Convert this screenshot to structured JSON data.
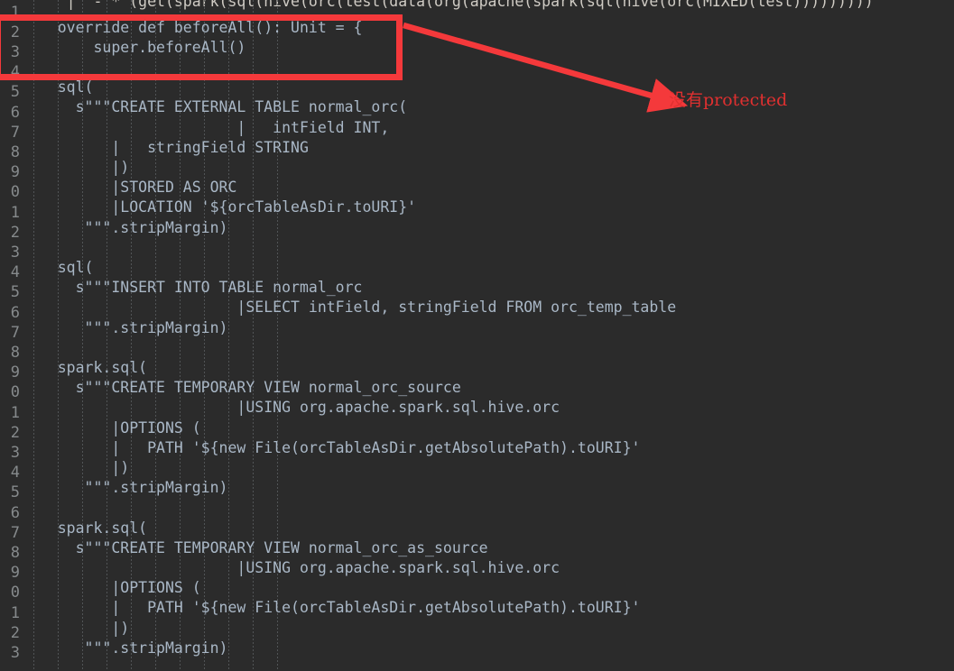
{
  "editor": {
    "theme_background": "#2b2b2b",
    "text_color": "#d6d6d0",
    "gutter_color": "#868a8c",
    "accent_color": "#f4393b"
  },
  "clipped_top_line": "     |  - * (get(spark(sql(hive(orc(test(data(org(apache(spark(sql(hive(orc(MIXED(test)))))))))",
  "line_numbers": [
    "1",
    "2",
    "3",
    "4",
    "5",
    "6",
    "7",
    "8",
    "9",
    "0",
    "1",
    "2",
    "3",
    "4",
    "5",
    "6",
    "7",
    "8",
    "9",
    "0",
    "1",
    "2",
    "3",
    "4",
    "5",
    "6",
    "7",
    "8",
    "9",
    "0",
    "1",
    "2",
    "3"
  ],
  "code_lines": [
    "    override def beforeAll(): Unit = {",
    "        super.beforeAll()",
    "",
    "    sql(",
    "      s\"\"\"CREATE EXTERNAL TABLE normal_orc(",
    "                        |   intField INT,",
    "          |   stringField STRING",
    "          |)",
    "          |STORED AS ORC",
    "          |LOCATION '${orcTableAsDir.toURI}'",
    "       \"\"\".stripMargin)",
    "",
    "    sql(",
    "      s\"\"\"INSERT INTO TABLE normal_orc",
    "                        |SELECT intField, stringField FROM orc_temp_table",
    "       \"\"\".stripMargin)",
    "",
    "    spark.sql(",
    "      s\"\"\"CREATE TEMPORARY VIEW normal_orc_source",
    "                        |USING org.apache.spark.sql.hive.orc",
    "          |OPTIONS (",
    "          |   PATH '${new File(orcTableAsDir.getAbsolutePath).toURI}'",
    "          |)",
    "       \"\"\".stripMargin)",
    "",
    "    spark.sql(",
    "      s\"\"\"CREATE TEMPORARY VIEW normal_orc_as_source",
    "                        |USING org.apache.spark.sql.hive.orc",
    "          |OPTIONS (",
    "          |   PATH '${new File(orcTableAsDir.getAbsolutePath).toURI}'",
    "          |)",
    "       \"\"\".stripMargin)"
  ],
  "annotation": {
    "text": "没有protected",
    "color": "#e03030",
    "box_label": "highlight-rectangle",
    "arrow_label": "pointer-arrow"
  }
}
